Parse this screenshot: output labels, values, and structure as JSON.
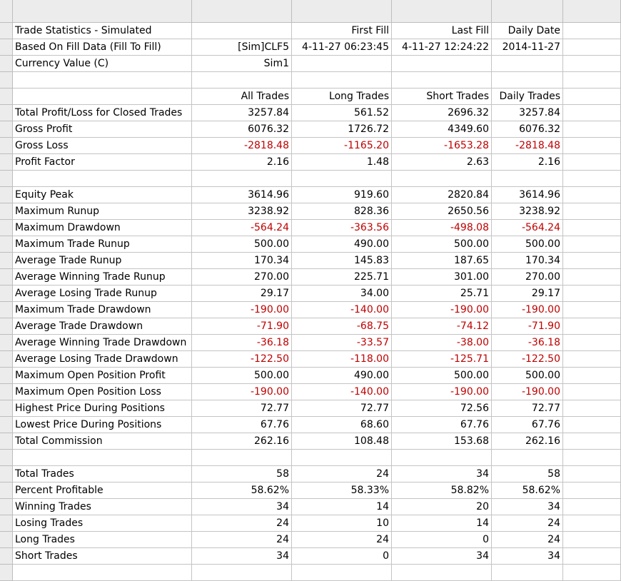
{
  "rows": [
    {
      "type": "header"
    },
    {
      "cells": [
        "Trade Statistics - Simulated",
        "",
        "First Fill",
        "Last Fill",
        "Daily Date"
      ]
    },
    {
      "cells": [
        "Based On Fill Data (Fill To Fill)",
        "[Sim]CLF5",
        "4-11-27  06:23:45",
        "4-11-27  12:24:22",
        "2014-11-27"
      ]
    },
    {
      "cells": [
        "Currency Value (C)",
        "Sim1",
        "",
        "",
        ""
      ]
    },
    {
      "cells": [
        "",
        "",
        "",
        "",
        ""
      ]
    },
    {
      "cells": [
        "",
        "All Trades",
        "Long Trades",
        "Short Trades",
        "Daily Trades"
      ]
    },
    {
      "cells": [
        "Total Profit/Loss for Closed Trades",
        "3257.84",
        "561.52",
        "2696.32",
        "3257.84"
      ]
    },
    {
      "cells": [
        "Gross Profit",
        "6076.32",
        "1726.72",
        "4349.60",
        "6076.32"
      ]
    },
    {
      "cells": [
        "Gross Loss",
        "-2818.48",
        "-1165.20",
        "-1653.28",
        "-2818.48"
      ],
      "negative": true
    },
    {
      "cells": [
        "Profit Factor",
        "2.16",
        "1.48",
        "2.63",
        "2.16"
      ]
    },
    {
      "cells": [
        "",
        "",
        "",
        "",
        ""
      ]
    },
    {
      "cells": [
        "Equity Peak",
        "3614.96",
        "919.60",
        "2820.84",
        "3614.96"
      ]
    },
    {
      "cells": [
        "Maximum Runup",
        "3238.92",
        "828.36",
        "2650.56",
        "3238.92"
      ]
    },
    {
      "cells": [
        "Maximum Drawdown",
        "-564.24",
        "-363.56",
        "-498.08",
        "-564.24"
      ],
      "negative": true
    },
    {
      "cells": [
        "Maximum Trade Runup",
        "500.00",
        "490.00",
        "500.00",
        "500.00"
      ]
    },
    {
      "cells": [
        "Average Trade Runup",
        "170.34",
        "145.83",
        "187.65",
        "170.34"
      ]
    },
    {
      "cells": [
        "Average Winning Trade Runup",
        "270.00",
        "225.71",
        "301.00",
        "270.00"
      ]
    },
    {
      "cells": [
        "Average Losing Trade Runup",
        "29.17",
        "34.00",
        "25.71",
        "29.17"
      ]
    },
    {
      "cells": [
        "Maximum Trade Drawdown",
        "-190.00",
        "-140.00",
        "-190.00",
        "-190.00"
      ],
      "negative": true
    },
    {
      "cells": [
        "Average Trade Drawdown",
        "-71.90",
        "-68.75",
        "-74.12",
        "-71.90"
      ],
      "negative": true
    },
    {
      "cells": [
        "Average Winning Trade Drawdown",
        "-36.18",
        "-33.57",
        "-38.00",
        "-36.18"
      ],
      "negative": true
    },
    {
      "cells": [
        "Average Losing Trade Drawdown",
        "-122.50",
        "-118.00",
        "-125.71",
        "-122.50"
      ],
      "negative": true
    },
    {
      "cells": [
        "Maximum Open Position Profit",
        "500.00",
        "490.00",
        "500.00",
        "500.00"
      ]
    },
    {
      "cells": [
        "Maximum Open Position Loss",
        "-190.00",
        "-140.00",
        "-190.00",
        "-190.00"
      ],
      "negative": true
    },
    {
      "cells": [
        "Highest Price During Positions",
        "72.77",
        "72.77",
        "72.56",
        "72.77"
      ]
    },
    {
      "cells": [
        "Lowest Price During Positions",
        "67.76",
        "68.60",
        "67.76",
        "67.76"
      ]
    },
    {
      "cells": [
        "Total Commission",
        "262.16",
        "108.48",
        "153.68",
        "262.16"
      ]
    },
    {
      "cells": [
        "",
        "",
        "",
        "",
        ""
      ]
    },
    {
      "cells": [
        "Total Trades",
        "58",
        "24",
        "34",
        "58"
      ]
    },
    {
      "cells": [
        "Percent Profitable",
        "58.62%",
        "58.33%",
        "58.82%",
        "58.62%"
      ]
    },
    {
      "cells": [
        "Winning Trades",
        "34",
        "14",
        "20",
        "34"
      ]
    },
    {
      "cells": [
        "Losing Trades",
        "24",
        "10",
        "14",
        "24"
      ]
    },
    {
      "cells": [
        "Long Trades",
        "24",
        "24",
        "0",
        "24"
      ]
    },
    {
      "cells": [
        "Short Trades",
        "34",
        "0",
        "34",
        "34"
      ]
    },
    {
      "cells": [
        "",
        "",
        "",
        "",
        ""
      ]
    }
  ],
  "colors": {
    "negative": "#c00000",
    "grid": "#c4c4c4",
    "header": "#ececec"
  }
}
